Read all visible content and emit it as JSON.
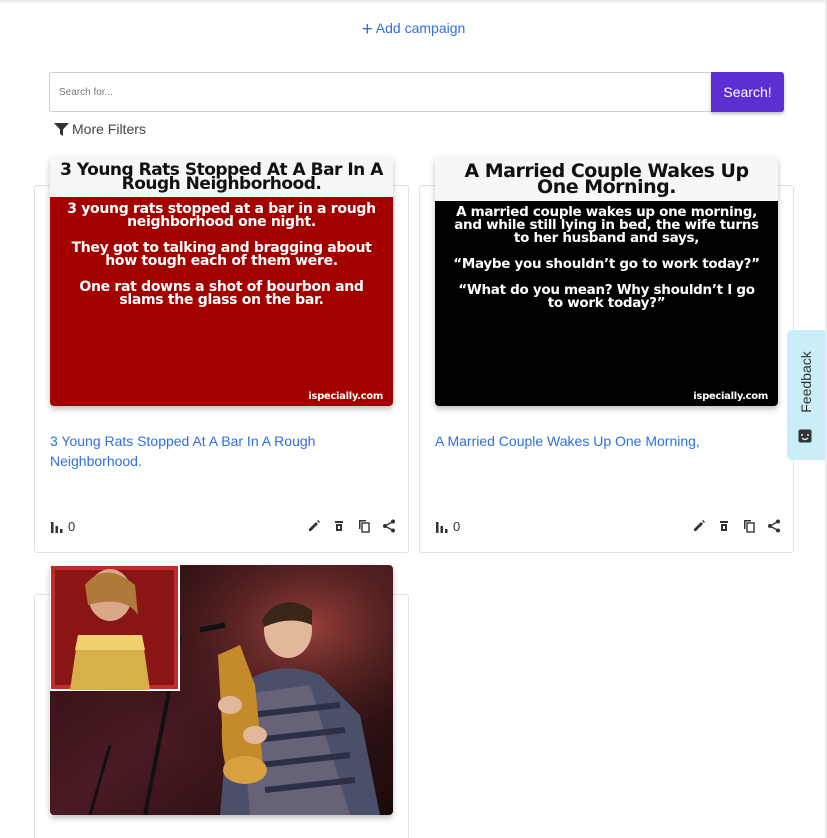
{
  "header": {
    "add_campaign": "Add campaign"
  },
  "search": {
    "placeholder": "Search for...",
    "button": "Search!"
  },
  "filters": {
    "label": "More Filters"
  },
  "campaigns": [
    {
      "title": "3 Young Rats Stopped At A Bar In A Rough Neighborhood.",
      "views": "0",
      "image": {
        "heading": "3 Young Rats Stopped At A Bar In A Rough Neighborhood.",
        "paragraphs": [
          "3 young rats stopped at a bar in a rough neighborhood one night.",
          "They got to talking and bragging about how tough each of them were.",
          "One rat downs a shot of bourbon and slams the glass on the bar."
        ],
        "watermark": "ispecially.com",
        "background": "#a30000"
      }
    },
    {
      "title": "A Married Couple Wakes Up One Morning,",
      "views": "0",
      "image": {
        "heading": "A Married Couple Wakes Up One Morning.",
        "paragraphs": [
          "A married couple wakes up one morning, and while still lying in bed, the wife turns to her husband and says,",
          "“Maybe you shouldn’t go to work today?”",
          "“What do you mean? Why shouldn’t I go to work today?”"
        ],
        "watermark": "ispecially.com",
        "background": "#000000"
      }
    },
    {
      "title": "",
      "views": ""
    }
  ],
  "feedback": {
    "label": "Feedback"
  },
  "colors": {
    "link": "#2f6fde",
    "search_button": "#5b2fd4",
    "feedback_tab": "#c9eef7"
  }
}
